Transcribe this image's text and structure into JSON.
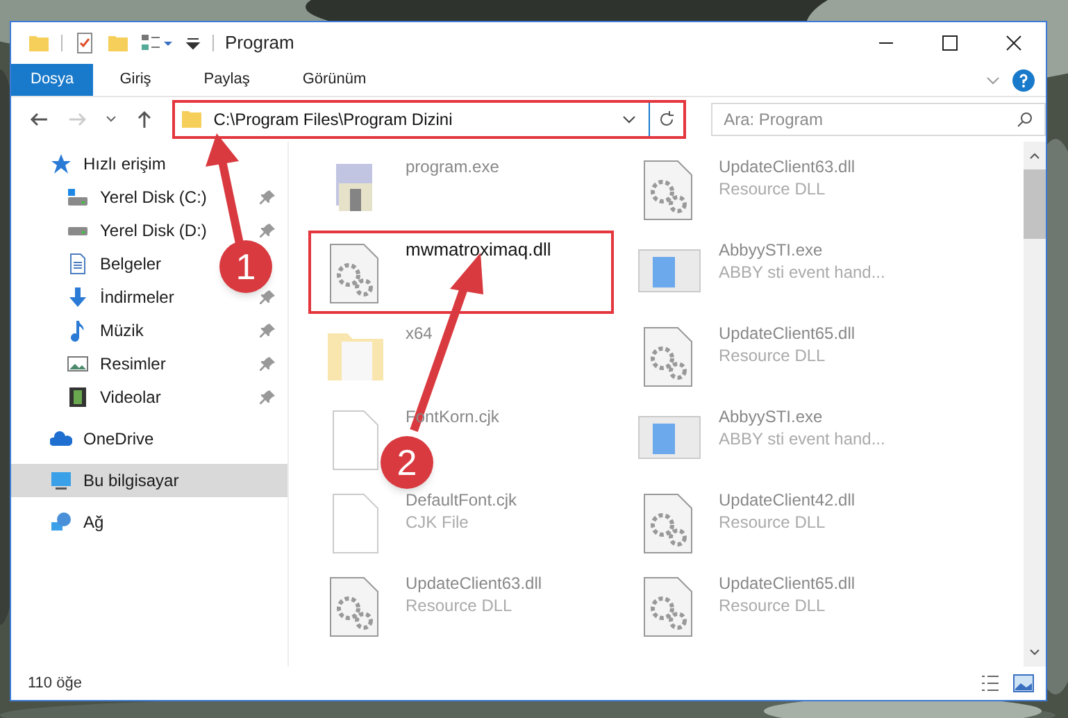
{
  "window": {
    "title": "Program"
  },
  "ribbon": {
    "tabs": [
      {
        "label": "Dosya",
        "selected": true
      },
      {
        "label": "Giriş",
        "selected": false
      },
      {
        "label": "Paylaş",
        "selected": false
      },
      {
        "label": "Görünüm",
        "selected": false
      }
    ]
  },
  "address": {
    "path": "C:\\Program Files\\Program Dizini",
    "highlighted": true
  },
  "search": {
    "placeholder": "Ara: Program"
  },
  "sidebar": {
    "items": [
      {
        "label": "Hızlı erişim",
        "kind": "star",
        "selected": false,
        "children": [
          {
            "label": "Yerel Disk (C:)",
            "kind": "drive-c",
            "pinned": true,
            "selected": false
          },
          {
            "label": "Yerel Disk (D:)",
            "kind": "drive",
            "pinned": true,
            "selected": false
          },
          {
            "label": "Belgeler",
            "kind": "document",
            "pinned": false,
            "selected": false
          },
          {
            "label": "İndirmeler",
            "kind": "download",
            "pinned": true,
            "selected": false
          },
          {
            "label": "Müzik",
            "kind": "music",
            "pinned": true,
            "selected": false
          },
          {
            "label": "Resimler",
            "pinned": true,
            "selected": false
          },
          {
            "label": "Videolar",
            "kind": "video",
            "pinned": true,
            "selected": false
          }
        ]
      },
      {
        "label": "OneDrive",
        "kind": "cloud",
        "selected": false
      },
      {
        "label": "Bu bilgisayar",
        "kind": "computer",
        "selected": true
      },
      {
        "label": "Ağ",
        "kind": "network",
        "selected": false
      }
    ]
  },
  "files": [
    {
      "name": "program.exe",
      "kind": "installer",
      "highlighted": false
    },
    {
      "name": "UpdateClient63.dll",
      "type": "Resource DLL",
      "kind": "dll",
      "highlighted": false
    },
    {
      "name": "mwmatroximaq.dll",
      "kind": "dll",
      "highlighted": true
    },
    {
      "name": "AbbyySTI.exe",
      "type": "ABBY sti event hand...",
      "kind": "app",
      "highlighted": false
    },
    {
      "name": "x64",
      "kind": "folder",
      "highlighted": false
    },
    {
      "name": "UpdateClient65.dll",
      "type": "Resource DLL",
      "kind": "dll",
      "highlighted": false
    },
    {
      "name": "FontKorn.cjk",
      "kind": "blank",
      "highlighted": false
    },
    {
      "name": "AbbyySTI.exe",
      "type": "ABBY sti event hand...",
      "kind": "app",
      "highlighted": false
    },
    {
      "name": "DefaultFont.cjk",
      "type": "CJK File",
      "kind": "blank",
      "highlighted": false
    },
    {
      "name": "UpdateClient42.dll",
      "type": "Resource DLL",
      "kind": "dll",
      "highlighted": false
    },
    {
      "name": "UpdateClient63.dll",
      "type": "Resource DLL",
      "kind": "dll",
      "highlighted": false
    },
    {
      "name": "UpdateClient65.dll",
      "type": "Resource DLL",
      "kind": "dll",
      "highlighted": false
    }
  ],
  "annotations": [
    {
      "number": "1"
    },
    {
      "number": "2"
    }
  ],
  "status_bar": {
    "count": "110 öğe"
  }
}
